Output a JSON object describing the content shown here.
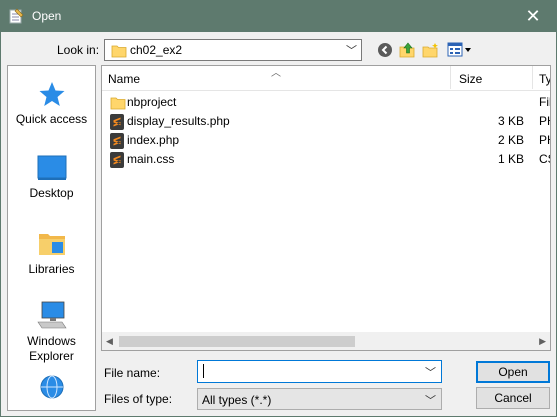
{
  "window": {
    "title": "Open",
    "close_icon": "close-icon"
  },
  "toolbar": {
    "look_in_label": "Look in:",
    "look_in_value": "ch02_ex2",
    "back_icon": "back-arrow-icon",
    "up_icon": "up-folder-icon",
    "new_folder_icon": "new-folder-icon",
    "view_menu_icon": "view-menu-icon"
  },
  "places": [
    {
      "label": "Quick access",
      "icon": "star-icon"
    },
    {
      "label": "Desktop",
      "icon": "desktop-icon"
    },
    {
      "label": "Libraries",
      "icon": "libraries-icon"
    },
    {
      "label": "Windows Explorer",
      "icon": "computer-icon"
    },
    {
      "label": "",
      "icon": "network-globe-icon"
    }
  ],
  "columns": {
    "name": "Name",
    "size": "Size",
    "type": "Typ"
  },
  "files": [
    {
      "name": "nbproject",
      "size": "",
      "type": "Fil",
      "icon": "folder-icon"
    },
    {
      "name": "display_results.php",
      "size": "3 KB",
      "type": "PH",
      "icon": "sublime-file-icon"
    },
    {
      "name": "index.php",
      "size": "2 KB",
      "type": "PH",
      "icon": "sublime-file-icon"
    },
    {
      "name": "main.css",
      "size": "1 KB",
      "type": "CS",
      "icon": "sublime-file-icon"
    }
  ],
  "form": {
    "file_name_label": "File name:",
    "file_name_value": "",
    "file_type_label": "Files of type:",
    "file_type_value": "All types (*.*)"
  },
  "buttons": {
    "open": "Open",
    "cancel": "Cancel"
  },
  "colors": {
    "titlebar": "#5e7a6e",
    "accent": "#0078d7",
    "sublime": "#f58b1f",
    "folder": "#ffd66b"
  }
}
